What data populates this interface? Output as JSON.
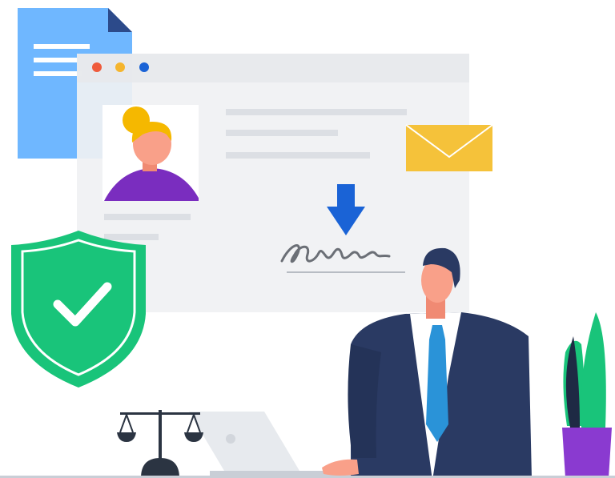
{
  "illustration": {
    "window": {
      "traffic_lights": [
        "#ef5b3c",
        "#f5b52e",
        "#1a63d6"
      ],
      "panel_color": "#f0f1f3",
      "line_color": "#dcdfe4"
    },
    "document_icon_color": "#6fb7ff",
    "envelope_color": "#f5c23a",
    "shield_color": "#19c47a",
    "download_arrow_color": "#1a63d6",
    "suit_color": "#2a3a63",
    "tie_color": "#2a93d8",
    "plant_pot_color": "#8a3ad0",
    "avatar_hair_color": "#f5b800",
    "avatar_shirt_color": "#7a2dbf"
  }
}
